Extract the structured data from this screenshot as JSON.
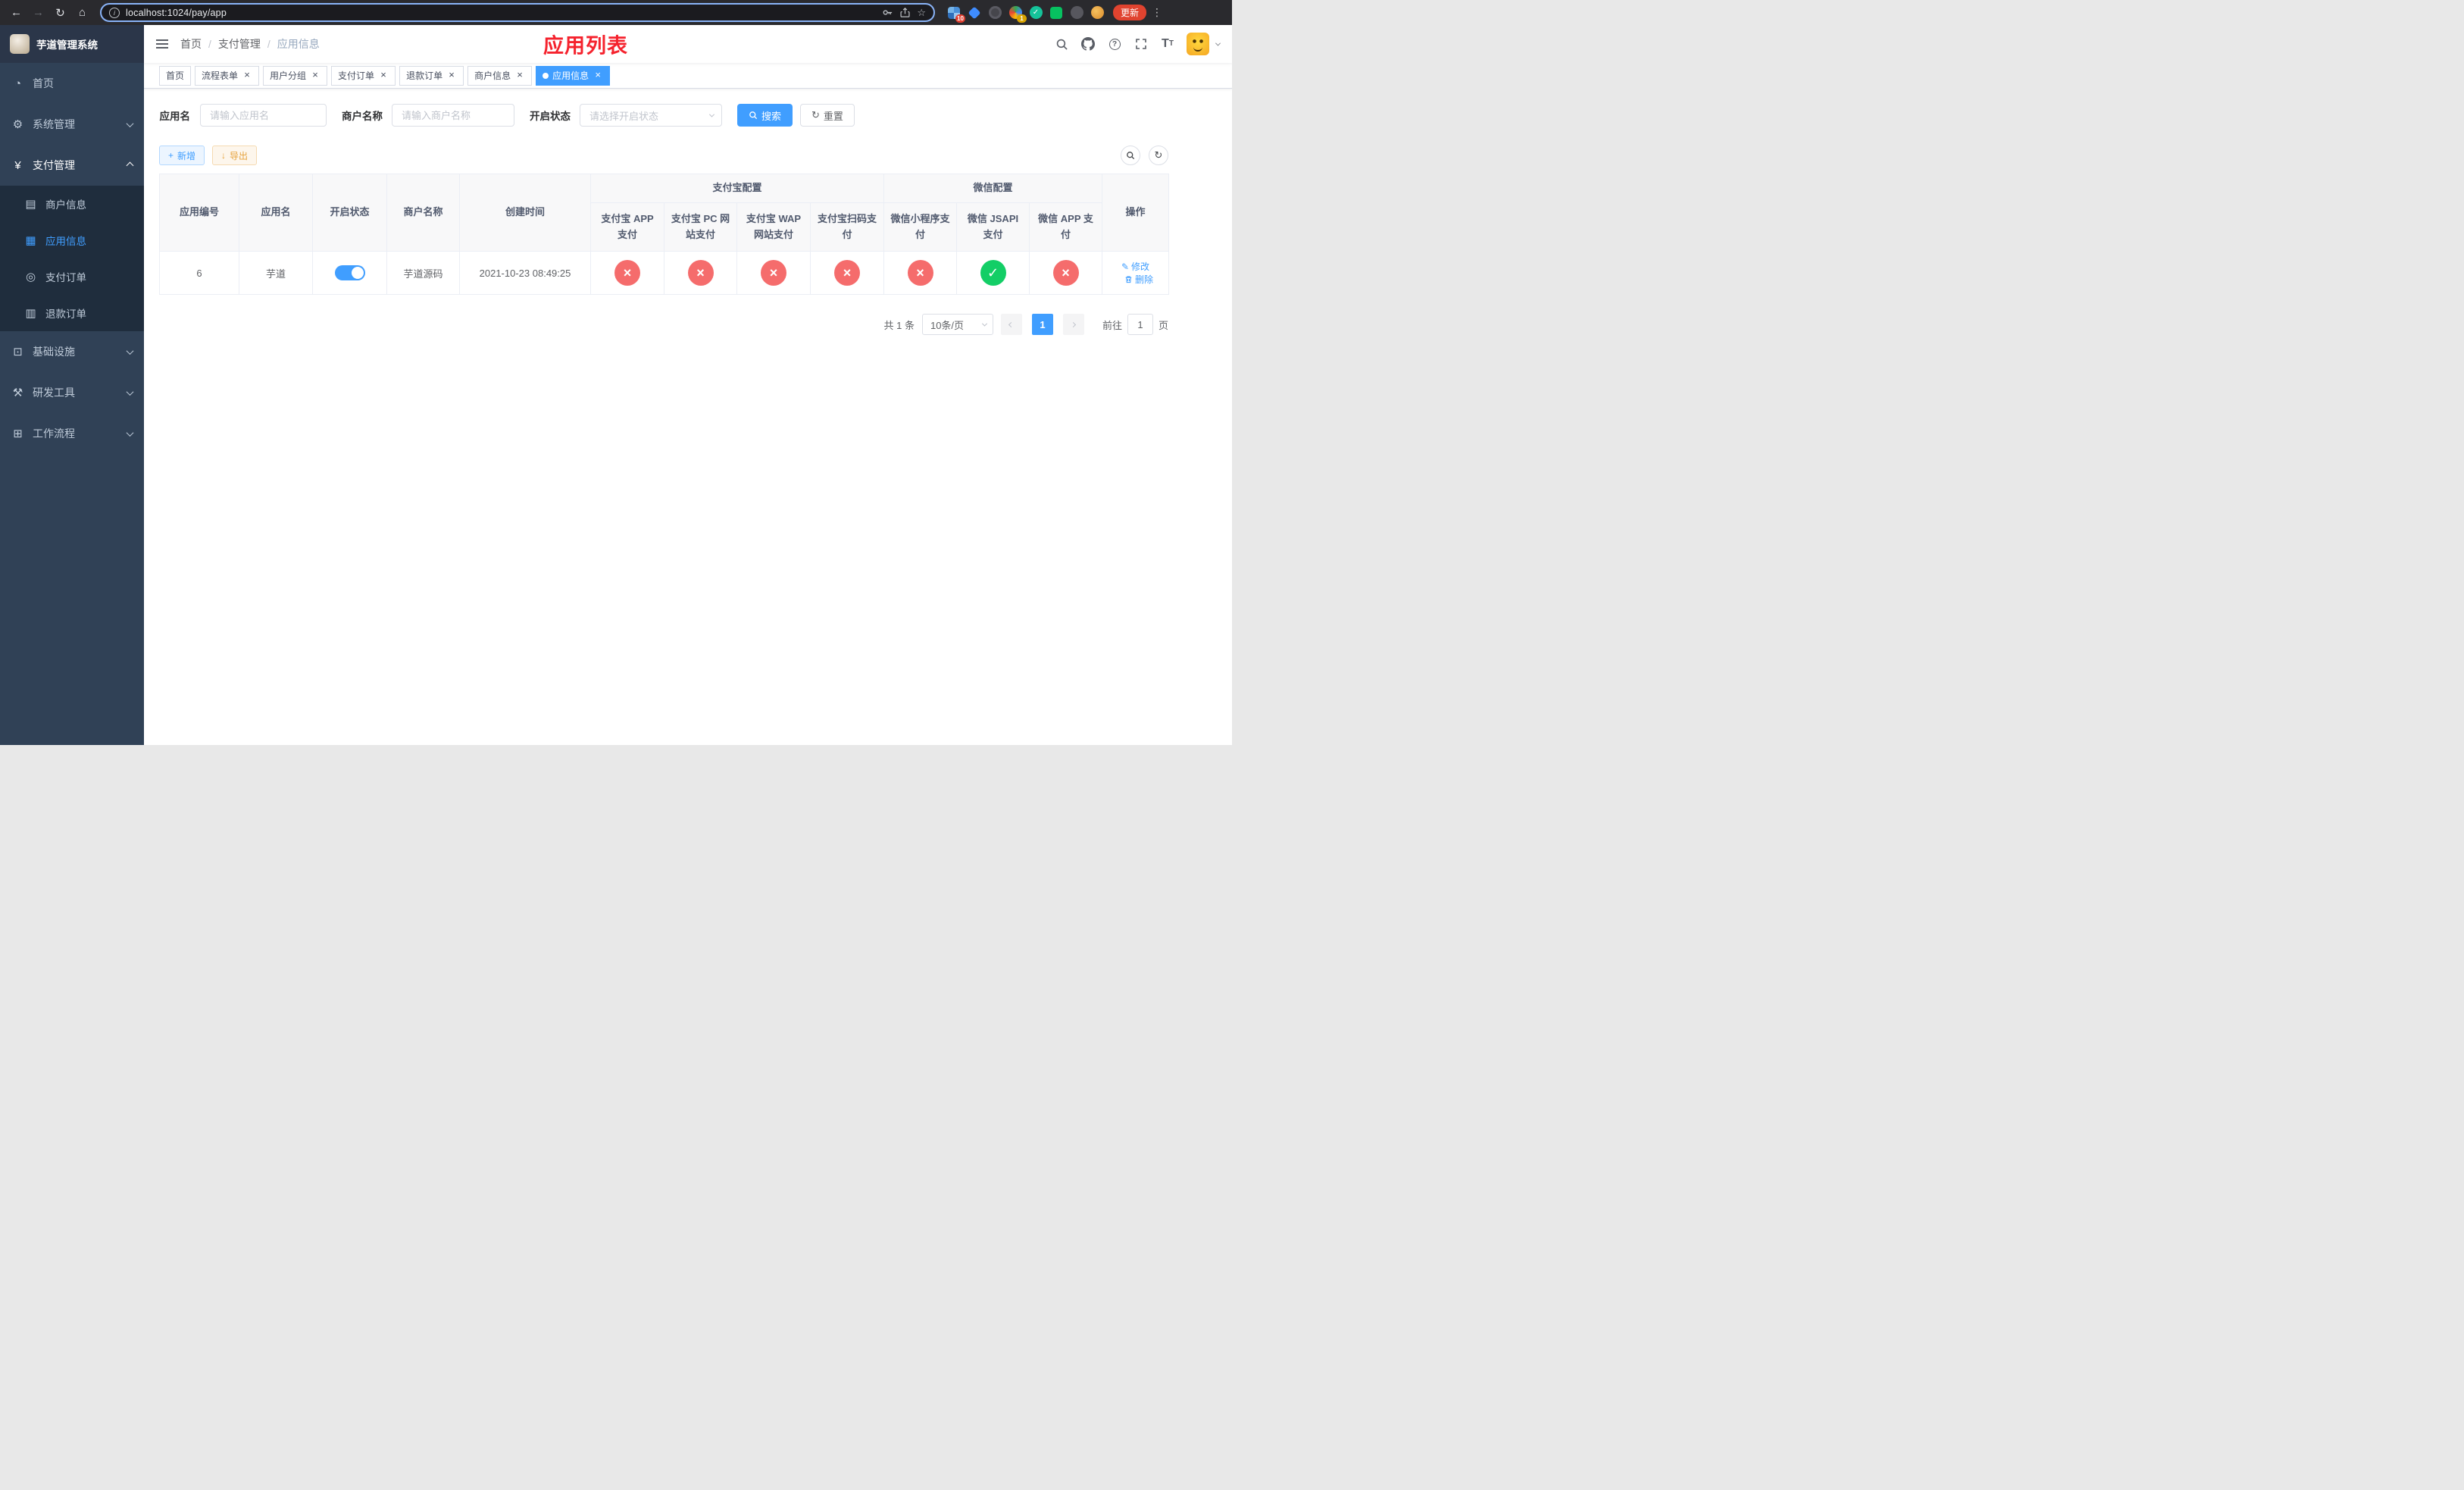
{
  "browser": {
    "url": "localhost:1024/pay/app",
    "update_button": "更新",
    "extension_badges": {
      "grid": "10",
      "rainbow": "1"
    }
  },
  "sidebar": {
    "logo_title": "芋道管理系统",
    "menu": [
      {
        "label": "首页"
      },
      {
        "label": "系统管理"
      },
      {
        "label": "支付管理",
        "children": [
          {
            "label": "商户信息"
          },
          {
            "label": "应用信息",
            "active": true
          },
          {
            "label": "支付订单"
          },
          {
            "label": "退款订单"
          }
        ]
      },
      {
        "label": "基础设施"
      },
      {
        "label": "研发工具"
      },
      {
        "label": "工作流程"
      }
    ]
  },
  "navbar": {
    "breadcrumb": [
      "首页",
      "支付管理",
      "应用信息"
    ],
    "overlay_title": "应用列表"
  },
  "tabs": {
    "items": [
      {
        "label": "首页",
        "closable": false
      },
      {
        "label": "流程表单",
        "closable": true
      },
      {
        "label": "用户分组",
        "closable": true
      },
      {
        "label": "支付订单",
        "closable": true
      },
      {
        "label": "退款订单",
        "closable": true
      },
      {
        "label": "商户信息",
        "closable": true
      },
      {
        "label": "应用信息",
        "closable": true,
        "active": true
      }
    ]
  },
  "filters": {
    "fields": [
      {
        "label": "应用名",
        "placeholder": "请输入应用名",
        "type": "input"
      },
      {
        "label": "商户名称",
        "placeholder": "请输入商户名称",
        "type": "input"
      },
      {
        "label": "开启状态",
        "placeholder": "请选择开启状态",
        "type": "select"
      }
    ],
    "search_button": "搜索",
    "reset_button": "重置"
  },
  "toolbar": {
    "add_button": "新增",
    "export_button": "导出"
  },
  "table": {
    "group_headers": {
      "alipay": "支付宝配置",
      "wechat": "微信配置"
    },
    "columns": [
      "应用编号",
      "应用名",
      "开启状态",
      "商户名称",
      "创建时间",
      "支付宝 APP 支付",
      "支付宝 PC 网站支付",
      "支付宝 WAP 网站支付",
      "支付宝扫码支付",
      "微信小程序支付",
      "微信 JSAPI 支付",
      "微信 APP 支付",
      "操作"
    ],
    "rows": [
      {
        "app_id": "6",
        "app_name": "芋道",
        "status_on": true,
        "merchant_name": "芋道源码",
        "create_time": "2021-10-23 08:49:25",
        "configs": [
          false,
          false,
          false,
          false,
          false,
          true,
          false
        ],
        "actions": {
          "edit": "修改",
          "delete": "删除"
        }
      }
    ]
  },
  "pagination": {
    "total_text": "共 1 条",
    "page_size": "10条/页",
    "current_page": "1",
    "goto_label": "前往",
    "goto_value": "1",
    "goto_unit": "页"
  },
  "icons": {
    "check": "✓",
    "cross": "×"
  },
  "colors": {
    "accent": "#409eff",
    "success": "#13ce66",
    "danger": "#f56c6c",
    "warning": "#e6a23c",
    "overlay_title": "#f5222d",
    "sidebar_bg": "#304156",
    "submenu_bg": "#1f2d3d"
  }
}
